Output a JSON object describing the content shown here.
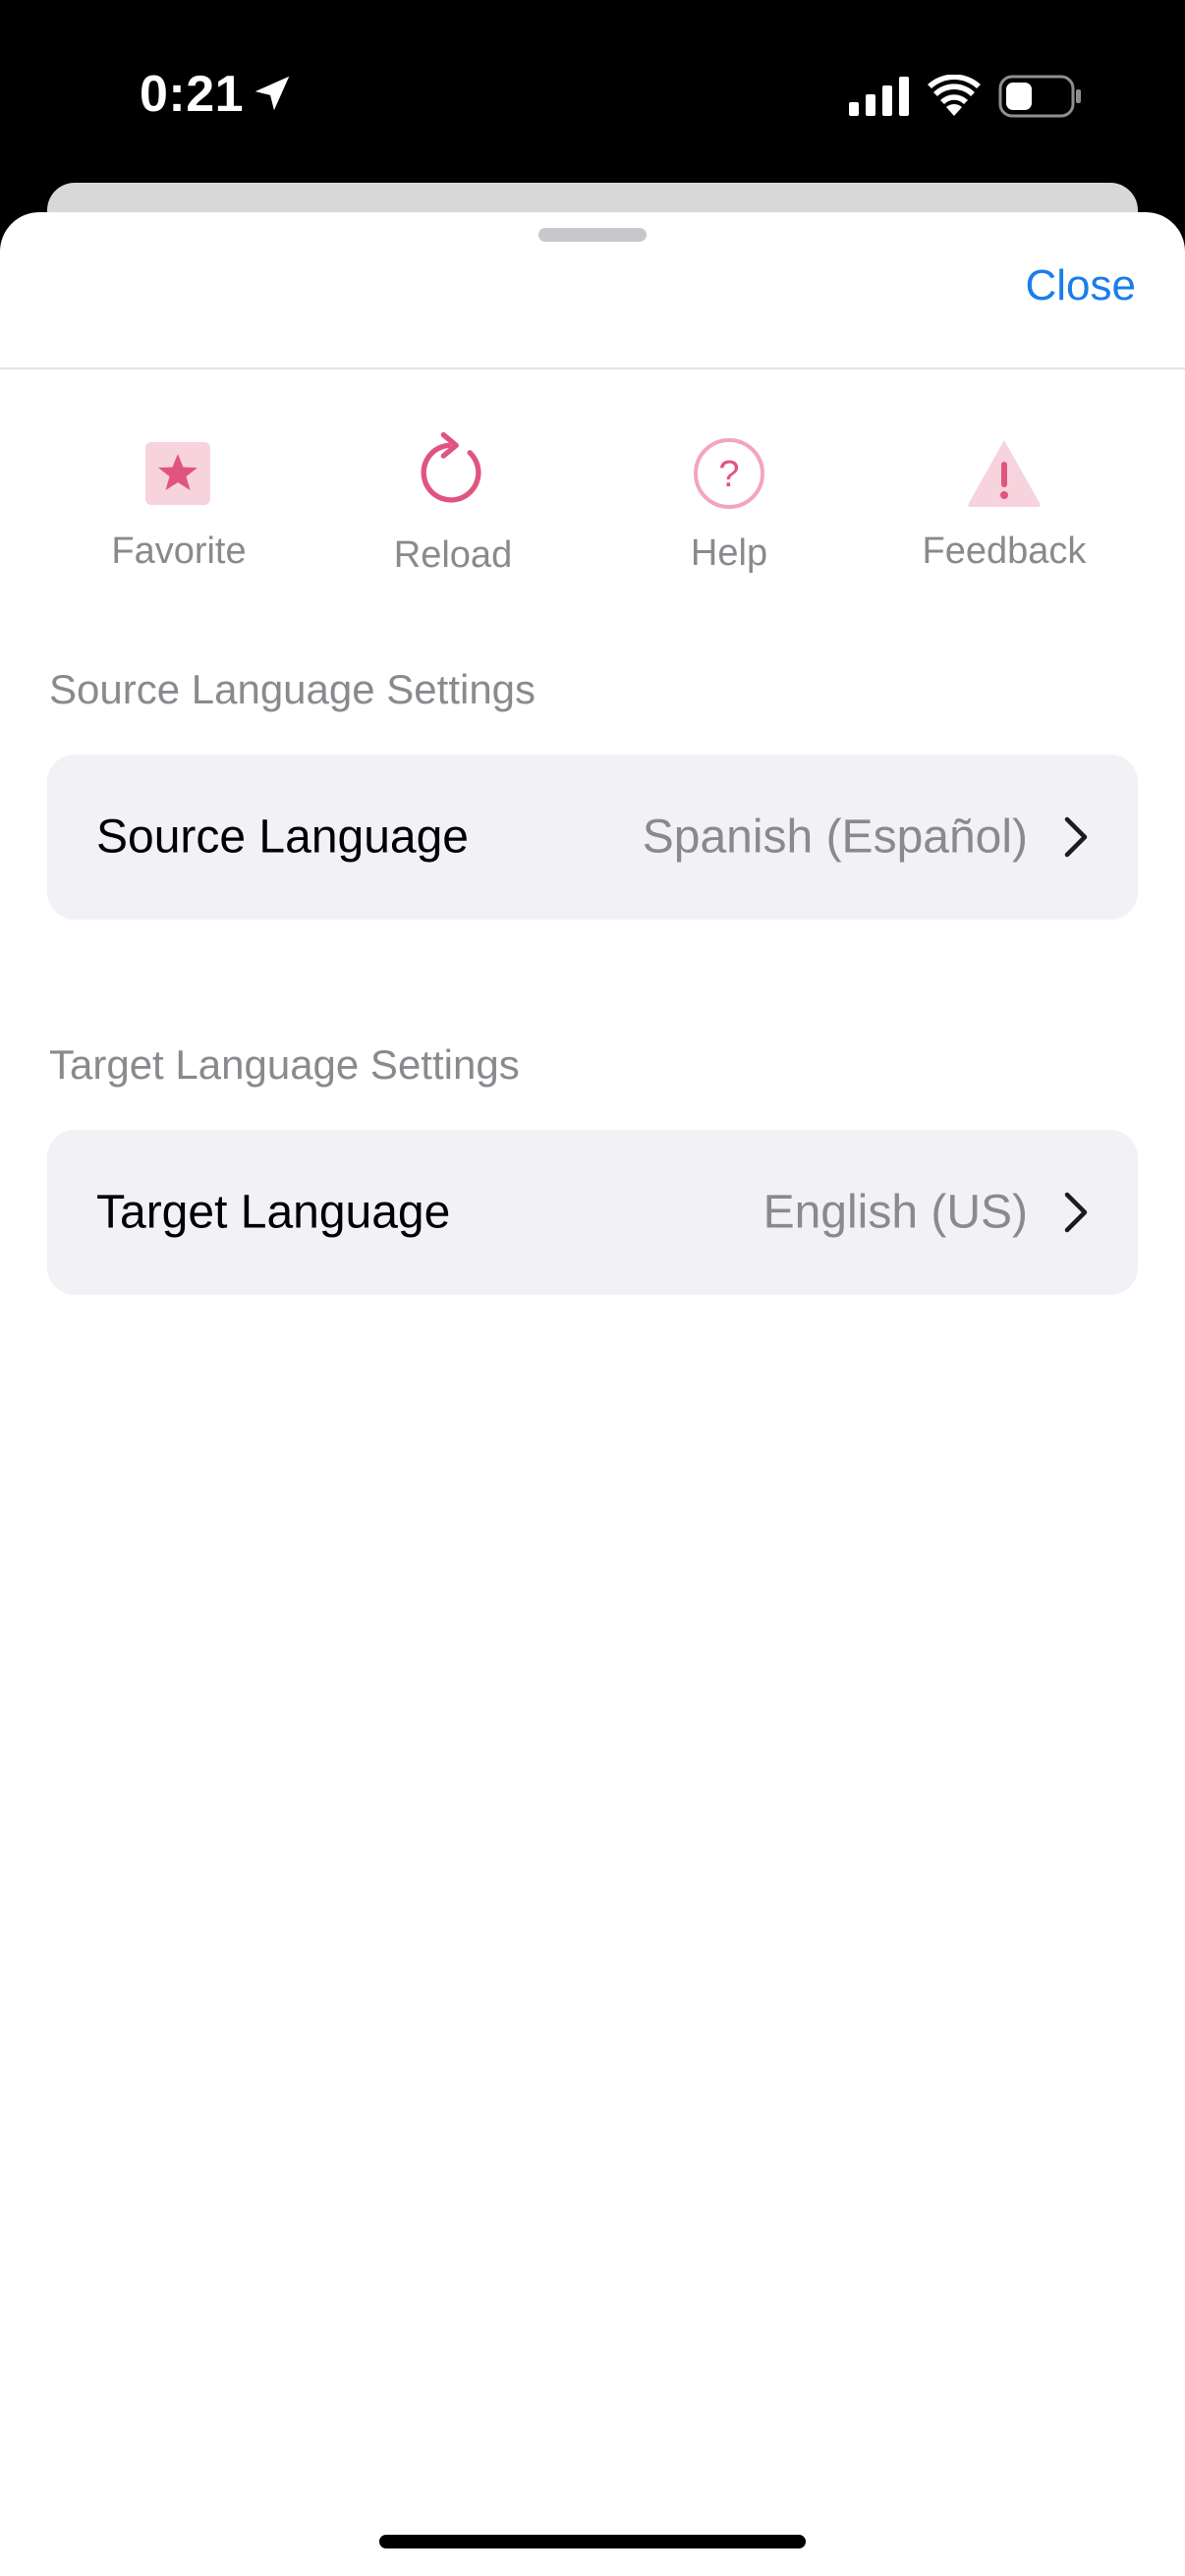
{
  "status_bar": {
    "time": "0:21"
  },
  "header": {
    "close_label": "Close"
  },
  "actions": [
    {
      "label": "Favorite",
      "icon": "star-icon"
    },
    {
      "label": "Reload",
      "icon": "reload-icon"
    },
    {
      "label": "Help",
      "icon": "help-icon"
    },
    {
      "label": "Feedback",
      "icon": "warning-icon"
    }
  ],
  "source_section": {
    "header": "Source Language Settings",
    "row_title": "Source Language",
    "row_value": "Spanish (Español)"
  },
  "target_section": {
    "header": "Target Language Settings",
    "row_title": "Target Language",
    "row_value": "English (US)"
  },
  "colors": {
    "accent_blue": "#1a7ee8",
    "icon_pink": "#e0557f",
    "icon_pink_light": "#f7d3de",
    "row_bg": "#f1f1f6",
    "secondary_text": "#8a8a8e"
  }
}
